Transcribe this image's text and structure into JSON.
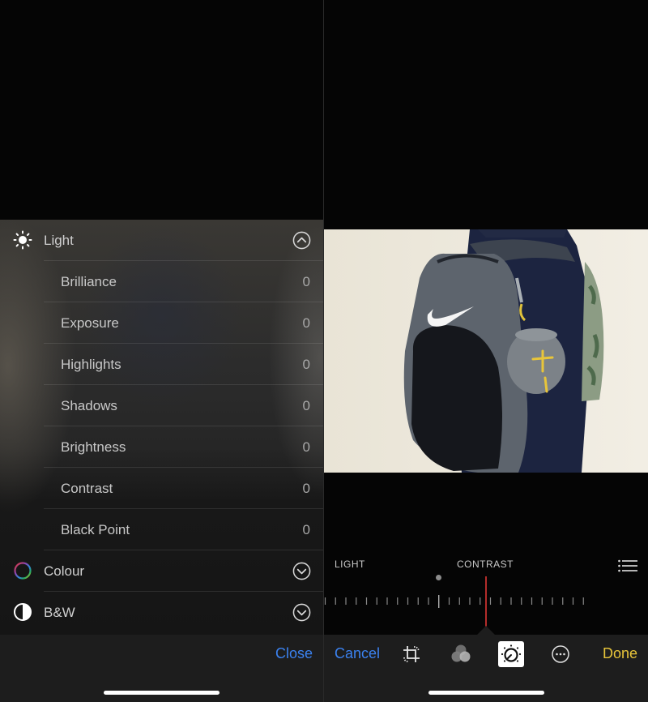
{
  "left_panel": {
    "sections": [
      {
        "id": "light",
        "label": "Light",
        "icon": "sun-icon",
        "expanded": true,
        "items": [
          {
            "label": "Brilliance",
            "value": "0"
          },
          {
            "label": "Exposure",
            "value": "0"
          },
          {
            "label": "Highlights",
            "value": "0"
          },
          {
            "label": "Shadows",
            "value": "0"
          },
          {
            "label": "Brightness",
            "value": "0"
          },
          {
            "label": "Contrast",
            "value": "0"
          },
          {
            "label": "Black Point",
            "value": "0"
          }
        ]
      },
      {
        "id": "colour",
        "label": "Colour",
        "icon": "colour-ring-icon",
        "expanded": false
      },
      {
        "id": "bw",
        "label": "B&W",
        "icon": "half-circle-icon",
        "expanded": false
      }
    ],
    "close_label": "Close"
  },
  "right_panel": {
    "photo_description": "Person wearing a grey Nike backpack with a grey speaker clipped on",
    "slider": {
      "category_label": "LIGHT",
      "active_label": "CONTRAST",
      "value": 0
    },
    "toolbar": {
      "cancel_label": "Cancel",
      "done_label": "Done",
      "tools": [
        "crop-rotate-icon",
        "filters-icon",
        "adjust-dial-icon",
        "more-icon"
      ],
      "active_tool": "adjust-dial-icon"
    }
  },
  "colors": {
    "accent_blue": "#3b82f0",
    "done_yellow": "#e8c53a",
    "needle_red": "#b42d2a"
  }
}
